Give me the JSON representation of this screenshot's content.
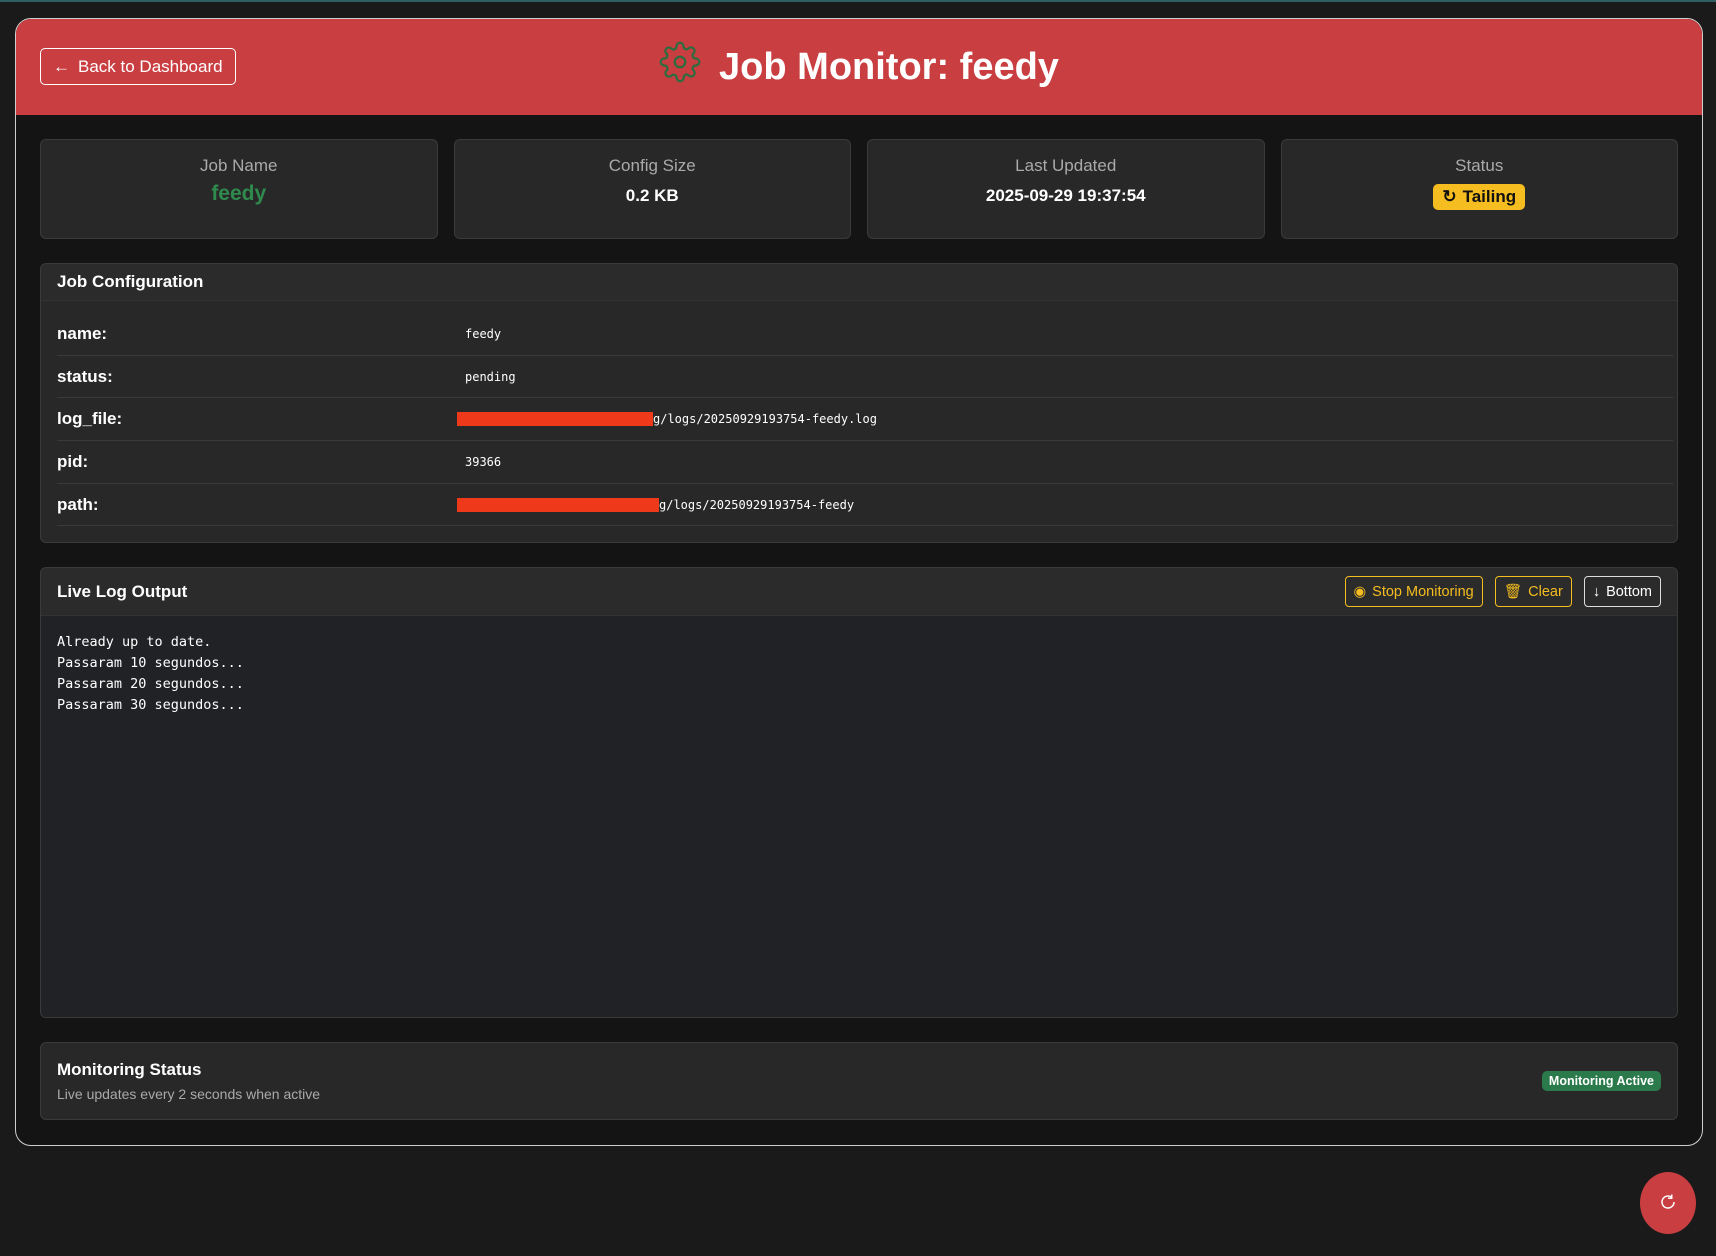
{
  "header": {
    "back_label": "Back to Dashboard",
    "title": "Job Monitor: feedy"
  },
  "cards": [
    {
      "label": "Job Name",
      "value": "feedy"
    },
    {
      "label": "Config Size",
      "value": "0.2 KB"
    },
    {
      "label": "Last Updated",
      "value": "2025-09-29 19:37:54"
    },
    {
      "label": "Status",
      "value": "Tailing"
    }
  ],
  "config": {
    "title": "Job Configuration",
    "rows": [
      {
        "key": "name:",
        "value": "feedy"
      },
      {
        "key": "status:",
        "value": "pending"
      },
      {
        "key": "log_file:",
        "value": "g/logs/20250929193754-feedy.log"
      },
      {
        "key": "pid:",
        "value": "39366"
      },
      {
        "key": "path:",
        "value": "g/logs/20250929193754-feedy"
      }
    ]
  },
  "log": {
    "title": "Live Log Output",
    "stop_label": "Stop Monitoring",
    "clear_label": "Clear",
    "bottom_label": "Bottom",
    "lines": [
      "Already up to date.",
      "Passaram 10 segundos...",
      "Passaram 20 segundos...",
      "Passaram 30 segundos..."
    ]
  },
  "monitoring": {
    "title": "Monitoring Status",
    "subtitle": "Live updates every 2 seconds when active",
    "badge": "Monitoring Active"
  },
  "colors": {
    "brand": "#c93e41",
    "warning": "#f5bd1f",
    "success": "#2b7a4b"
  }
}
